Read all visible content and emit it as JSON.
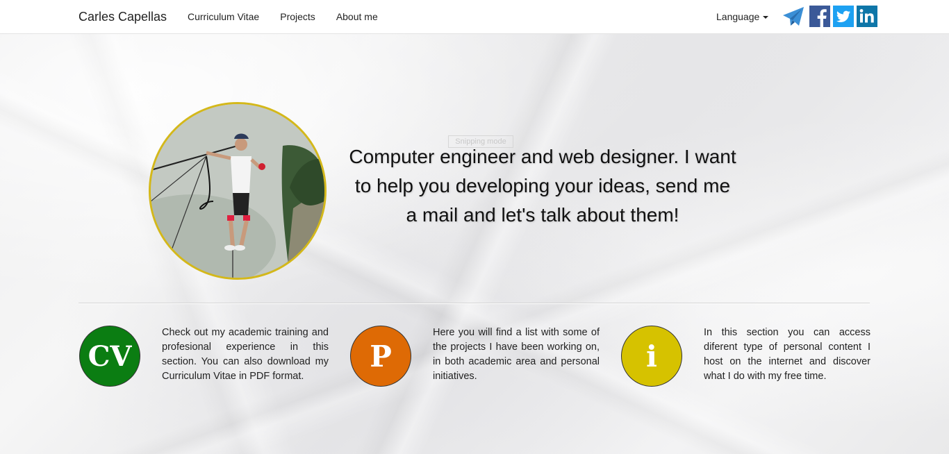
{
  "navbar": {
    "brand": "Carles Capellas",
    "links": [
      "Curriculum Vitae",
      "Projects",
      "About me"
    ],
    "language_label": "Language",
    "social": [
      {
        "name": "telegram-icon",
        "color": "#3b8fd6"
      },
      {
        "name": "facebook-icon",
        "color": "#3b5998"
      },
      {
        "name": "twitter-icon",
        "color": "#1da1f2"
      },
      {
        "name": "linkedin-icon",
        "color": "#0e76a8"
      }
    ]
  },
  "hero": {
    "text": "Computer engineer and web designer. I want to help you developing your ideas, send me a mail and let's talk about them!",
    "overlay_label": "Snipping mode",
    "avatar_border_color": "#d4b81a"
  },
  "sections": [
    {
      "icon_text": "CV",
      "color": "#0b7d12",
      "description": "Check out my academic training and profesional experience in this section. You can also download my Curriculum Vitae in PDF format."
    },
    {
      "icon_text": "P",
      "color": "#de6a05",
      "description": "Here you will find a list with some of the projects I have been working on, in both academic area and personal initiatives."
    },
    {
      "icon_text": "i",
      "color": "#d6c200",
      "description": "In this section you can access diferent type of personal content I host on the internet and discover what I do with my free time."
    }
  ]
}
